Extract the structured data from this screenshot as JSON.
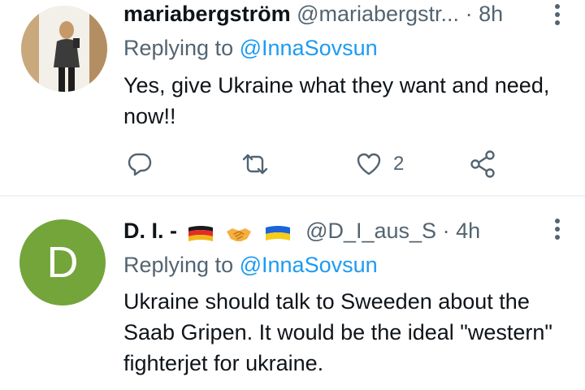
{
  "tweets": [
    {
      "display_name": "mariabergström",
      "handle": "@mariabergstr...",
      "separator": "·",
      "time": "8h",
      "replying_prefix": "Replying to",
      "replying_to": "@InnaSovsun",
      "text": "Yes, give Ukraine what they want and need, now!!",
      "actions": {
        "reply_icon": "reply-icon",
        "retweet_icon": "retweet-icon",
        "like_icon": "heart-icon",
        "like_count": "2",
        "share_icon": "share-icon"
      }
    },
    {
      "display_name": "D. I. -",
      "flags": [
        "flag-germany",
        "handshake",
        "flag-ukraine"
      ],
      "handle": "@D_I_aus_S",
      "separator": "·",
      "time": "4h",
      "avatar_letter": "D",
      "replying_prefix": "Replying to",
      "replying_to": "@InnaSovsun",
      "text": "Ukraine should talk to Sweeden about the Saab Gripen. It would be the ideal \"western\" fighterjet for ukraine."
    }
  ],
  "colors": {
    "link": "#1d9bf0",
    "secondary_text": "#536471",
    "primary_text": "#0f1419",
    "avatar_green": "#73a53a",
    "divider": "#eff3f4"
  }
}
